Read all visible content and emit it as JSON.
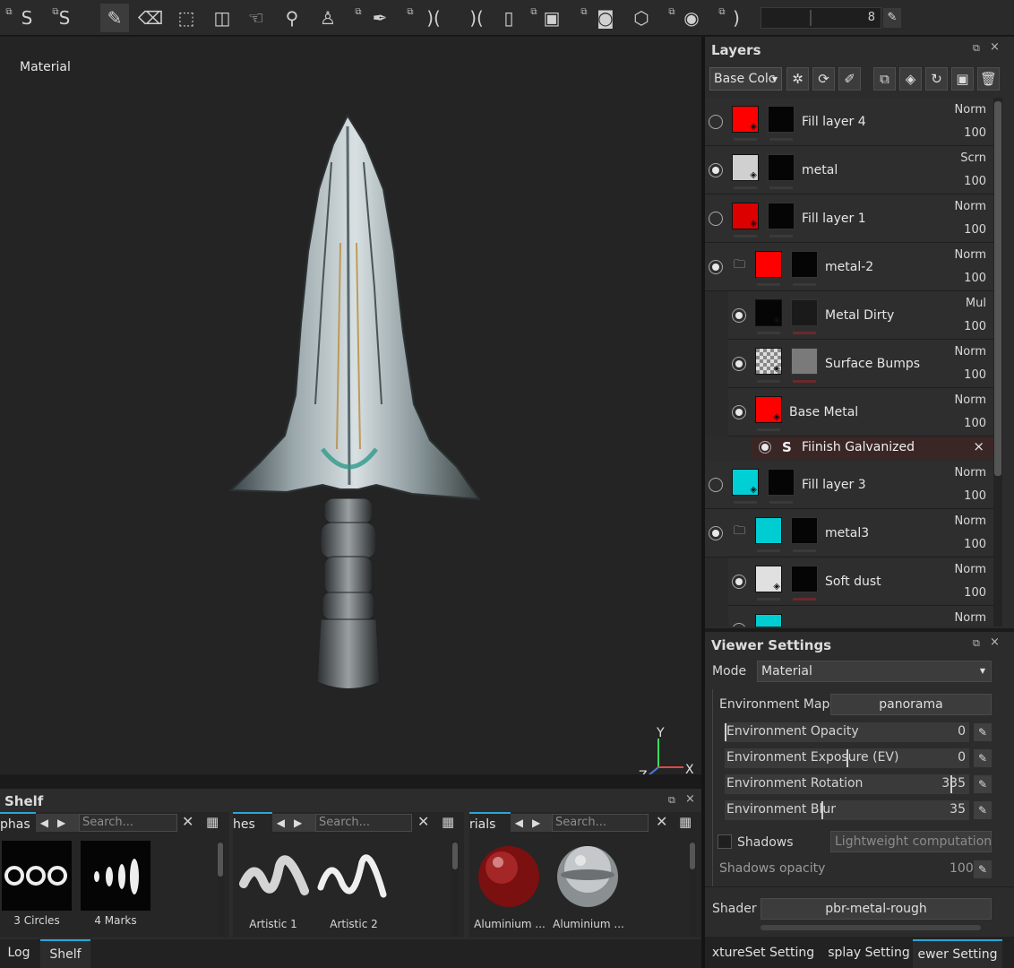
{
  "toolbar": {
    "tools": [
      {
        "name": "substance-logo-icon",
        "glyph": "S"
      },
      {
        "name": "bag-icon",
        "glyph": "S"
      },
      {
        "name": "paint-brush-icon",
        "glyph": "✎"
      },
      {
        "name": "eraser-icon",
        "glyph": "⌫"
      },
      {
        "name": "projection-icon",
        "glyph": "⬚"
      },
      {
        "name": "polygon-fill-icon",
        "glyph": "◫"
      },
      {
        "name": "smudge-icon",
        "glyph": "☜"
      },
      {
        "name": "clone-stamp-icon",
        "glyph": "⚲"
      },
      {
        "name": "stamp-icon",
        "glyph": "♙"
      },
      {
        "name": "color-picker-icon",
        "glyph": "✒"
      },
      {
        "name": "symmetry-icon",
        "glyph": ")("
      },
      {
        "name": "symmetry-x-icon",
        "glyph": ")("
      },
      {
        "name": "symmetry-mirror-icon",
        "glyph": "▯"
      },
      {
        "name": "cube-view-icon",
        "glyph": "▣"
      },
      {
        "name": "camera-icon",
        "glyph": "◙"
      },
      {
        "name": "cube-icon",
        "glyph": "⬡"
      },
      {
        "name": "screenshot-camera-icon",
        "glyph": "◉"
      },
      {
        "name": "lazy-mouse-icon",
        "glyph": ")"
      }
    ],
    "brush_size_value": "8",
    "pen_glyph": "✎"
  },
  "viewport": {
    "mode_label": "Material",
    "axis": {
      "y": "Y",
      "x": "X",
      "z": "Z"
    }
  },
  "layers": {
    "title": "Layers",
    "float_glyph": "⧉",
    "close_glyph": "×",
    "channel": "Base Colc",
    "tool_glyphs": [
      "✲",
      "⟳",
      "✐",
      "⧉",
      "◈",
      "↻",
      "▣",
      "🗑"
    ],
    "items": [
      {
        "name": "Fill layer 4",
        "blend": "Norm",
        "opacity": "100",
        "visible": false,
        "color": "#ff0000",
        "mask": "#050505",
        "indent": 0,
        "folder": false
      },
      {
        "name": "metal",
        "blend": "Scrn",
        "opacity": "100",
        "visible": true,
        "color": "#d0d0d0",
        "mask": "#050505",
        "indent": 0,
        "folder": false
      },
      {
        "name": "Fill layer 1",
        "blend": "Norm",
        "opacity": "100",
        "visible": false,
        "color": "#dd0000",
        "mask": "#050505",
        "indent": 0,
        "folder": false
      },
      {
        "name": "metal-2",
        "blend": "Norm",
        "opacity": "100",
        "visible": true,
        "color": "#ff0000",
        "mask": "#050505",
        "indent": 0,
        "folder": true
      },
      {
        "name": "Metal Dirty",
        "blend": "Mul",
        "opacity": "100",
        "visible": true,
        "color": "#050505",
        "mask": "#1a1a1a",
        "indent": 1,
        "folder": false
      },
      {
        "name": "Surface Bumps",
        "blend": "Norm",
        "opacity": "100",
        "visible": true,
        "color": "checker",
        "mask": "#7a7a7a",
        "indent": 1,
        "folder": false
      },
      {
        "name": "Base Metal",
        "blend": "Norm",
        "opacity": "100",
        "visible": true,
        "color": "#ff0000",
        "mask": "",
        "indent": 1,
        "folder": false
      },
      {
        "name": "Fill layer 3",
        "blend": "Norm",
        "opacity": "100",
        "visible": false,
        "color": "#00d0d6",
        "mask": "#050505",
        "indent": 0,
        "folder": false
      },
      {
        "name": "metal3",
        "blend": "Norm",
        "opacity": "100",
        "visible": true,
        "color": "#00cdd2",
        "mask": "#050505",
        "indent": 0,
        "folder": true
      },
      {
        "name": "Soft dust",
        "blend": "Norm",
        "opacity": "100",
        "visible": true,
        "color": "#e0e0e0",
        "mask": "#050505",
        "indent": 1,
        "folder": false
      },
      {
        "name": "",
        "blend": "Norm",
        "opacity": "",
        "visible": true,
        "color": "#00cdd2",
        "mask": "",
        "indent": 1,
        "folder": false
      }
    ],
    "effect": {
      "name": "Fiinish Galvanized",
      "logo": "S",
      "close": "×"
    }
  },
  "viewer_settings": {
    "title": "Viewer Settings",
    "mode_label": "Mode",
    "mode_value": "Material",
    "env_map_label": "Environment Map",
    "env_map_value": "panorama",
    "sliders": [
      {
        "label": "Environment Opacity",
        "value": "0",
        "fraction": 0.0
      },
      {
        "label": "Environment Exposure (EV)",
        "value": "0",
        "fraction": 0.5
      },
      {
        "label": "Environment Rotation",
        "value": "335",
        "fraction": 0.93
      },
      {
        "label": "Environment Blur",
        "value": "35",
        "fraction": 0.4
      }
    ],
    "shadows_label": "Shadows",
    "shadows_mode": "Lightweight computation",
    "shadows_opacity_label": "Shadows opacity",
    "shadows_opacity_value": "100",
    "shader_label": "Shader",
    "shader_value": "pbr-metal-rough"
  },
  "shelf": {
    "title": "Shelf",
    "sections": [
      {
        "tab": "phas",
        "search": "Search...",
        "items": [
          {
            "label": "3 Circles"
          },
          {
            "label": "4 Marks"
          }
        ]
      },
      {
        "tab": "hes",
        "search": "Search...",
        "items": [
          {
            "label": "Artistic 1"
          },
          {
            "label": "Artistic 2"
          }
        ]
      },
      {
        "tab": "rials",
        "search": "Search...",
        "items": [
          {
            "label": "Aluminium ..."
          },
          {
            "label": "Aluminium ..."
          }
        ]
      }
    ]
  },
  "bottom_tabs": {
    "left": [
      "Log",
      "Shelf"
    ],
    "right": [
      "xtureSet Setting",
      "splay Setting",
      "ewer Setting"
    ]
  }
}
